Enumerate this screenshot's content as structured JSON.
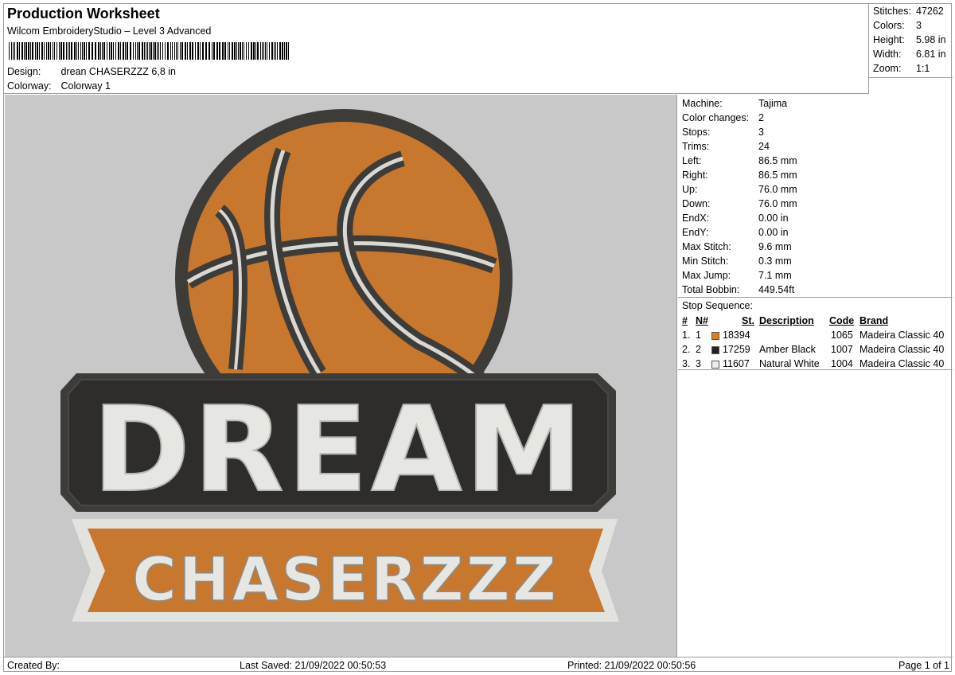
{
  "header": {
    "title": "Production Worksheet",
    "software": "Wilcom EmbroideryStudio – Level 3 Advanced",
    "design_label": "Design:",
    "design_value": "drean CHASERZZZ  6,8 in",
    "colorway_label": "Colorway:",
    "colorway_value": "Colorway 1"
  },
  "stats": {
    "stitches_label": "Stitches:",
    "stitches": "47262",
    "colors_label": "Colors:",
    "colors": "3",
    "height_label": "Height:",
    "height": "5.98 in",
    "width_label": "Width:",
    "width": "6.81 in",
    "zoom_label": "Zoom:",
    "zoom": "1:1"
  },
  "machine_info": [
    {
      "label": "Machine:",
      "value": "Tajima"
    },
    {
      "label": "Color changes:",
      "value": "2"
    },
    {
      "label": "Stops:",
      "value": "3"
    },
    {
      "label": "Trims:",
      "value": "24"
    },
    {
      "label": "Left:",
      "value": "86.5 mm"
    },
    {
      "label": "Right:",
      "value": "86.5 mm"
    },
    {
      "label": "Up:",
      "value": "76.0 mm"
    },
    {
      "label": "Down:",
      "value": "76.0 mm"
    },
    {
      "label": "EndX:",
      "value": "0.00 in"
    },
    {
      "label": "EndY:",
      "value": "0.00 in"
    },
    {
      "label": "Max Stitch:",
      "value": "9.6 mm"
    },
    {
      "label": "Min Stitch:",
      "value": "0.3 mm"
    },
    {
      "label": "Max Jump:",
      "value": "7.1 mm"
    },
    {
      "label": "Total Bobbin:",
      "value": "449.54ft"
    }
  ],
  "stop_sequence": {
    "title": "Stop Sequence:",
    "headers": {
      "num": "#",
      "n": "N#",
      "st": "St.",
      "desc": "Description",
      "code": "Code",
      "brand": "Brand"
    },
    "rows": [
      {
        "num": "1.",
        "n": "1",
        "color": "#e07b22",
        "st": "18394",
        "desc": "",
        "code": "1065",
        "brand": "Madeira Classic 40"
      },
      {
        "num": "2.",
        "n": "2",
        "color": "#222222",
        "st": "17259",
        "desc": "Amber Black",
        "code": "1007",
        "brand": "Madeira Classic 40"
      },
      {
        "num": "3.",
        "n": "3",
        "color": "#ececec",
        "st": "11607",
        "desc": "Natural White",
        "code": "1004",
        "brand": "Madeira Classic 40"
      }
    ]
  },
  "design_art": {
    "line1": "DREAM",
    "line2": "CHASERZZZ",
    "colors": {
      "orange": "#c8772e",
      "dark": "#3e3c39",
      "white": "#e6e6e2",
      "background": "#c8c8c8"
    }
  },
  "footer": {
    "created_by": "Created By:",
    "last_saved": "Last Saved: 21/09/2022 00:50:53",
    "printed": "Printed: 21/09/2022 00:50:56",
    "page": "Page 1 of 1"
  }
}
